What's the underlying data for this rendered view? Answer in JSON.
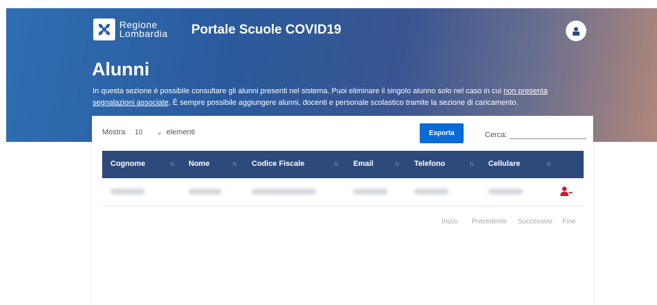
{
  "header": {
    "logo_line1": "Regione",
    "logo_line2": "Lombardia",
    "portal_title": "Portale Scuole COVID19"
  },
  "page": {
    "title": "Alunni",
    "intro_part1": "In questa sezione è possibile consultare gli alunni presenti nel sistema. Puoi eliminare il singolo alunno solo nel caso in cui ",
    "intro_link": "non presenta segnalazioni associate",
    "intro_part2": ". È sempre possibile aggiungere alunni, docenti e personale scolastico tramite la sezione di caricamento."
  },
  "table_controls": {
    "show_label": "Mostra",
    "page_length": "10",
    "elements_label": "elementi",
    "export_label": "Esporta",
    "search_label": "Cerca:",
    "search_value": ""
  },
  "table": {
    "columns": [
      "Cognome",
      "Nome",
      "Codice Fiscale",
      "Email",
      "Telefono",
      "Cellulare"
    ],
    "sort_glyph": "↑↓"
  },
  "pagination": {
    "first": "Inizio",
    "previous": "Precedente",
    "next": "Successivo",
    "last": "Fine"
  },
  "colors": {
    "header_bg": "#2c4a7c",
    "primary_button": "#0a6ad6",
    "delete_icon": "#d0192b"
  },
  "icons": {
    "logo": "regione-lombardia-logo-icon",
    "avatar": "user-icon",
    "delete": "remove-user-icon",
    "dropdown": "chevron-down-icon"
  }
}
